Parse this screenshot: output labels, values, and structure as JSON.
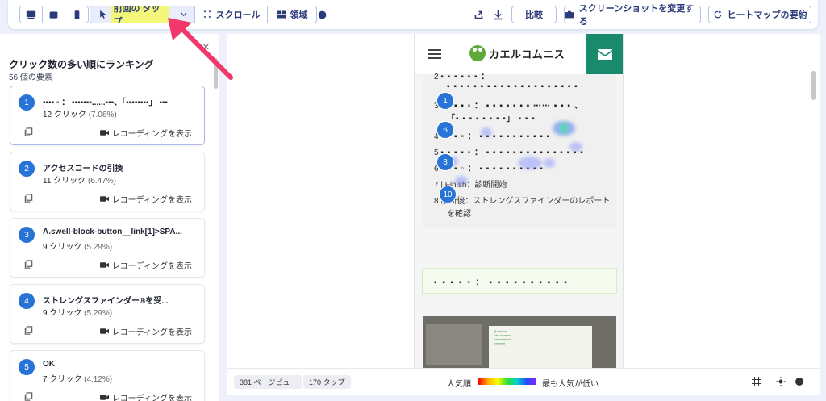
{
  "toolbar": {
    "tap_label": "前回の タップ",
    "scroll_label": "スクロール",
    "area_label": "領域",
    "compare_label": "比較",
    "screenshot_label": "スクリーンショットを変更する",
    "summary_label": "ヒートマップの要約"
  },
  "ranking": {
    "title": "クリック数の多い順にランキング",
    "element_count": "56 個の要素",
    "items": [
      {
        "rank": "1",
        "title": "▪▪▪▪ ▫ ： ▪▪▪▪▪▪▪......▪▪▪、「▪▪▪▪▪▪▪▪」 ▪▪▪",
        "clicks": "12 クリック",
        "pct": "(7.06%)",
        "record": "レコーディングを表示"
      },
      {
        "rank": "2",
        "title": "アクセスコードの引換",
        "clicks": "11 クリック",
        "pct": "(6.47%)",
        "record": "レコーディングを表示"
      },
      {
        "rank": "3",
        "title": "A.swell-block-button__link[1]>SPA...",
        "clicks": "9 クリック",
        "pct": "(5.29%)",
        "record": "レコーディングを表示"
      },
      {
        "rank": "4",
        "title": "ストレングスファインダー®を受...",
        "clicks": "9 クリック",
        "pct": "(5.29%)",
        "record": "レコーディングを表示"
      },
      {
        "rank": "5",
        "title": "OK",
        "clicks": "7 クリック",
        "pct": "(4.12%)",
        "record": "レコーディングを表示"
      }
    ]
  },
  "preview": {
    "logo_text": "カエルコムニス",
    "toc": [
      {
        "num": "2",
        "text": "▪ ▪ ▪ ▪ ▪ ▪ ："
      },
      {
        "num": "",
        "text": "▪ ▪ ▪ ▪ ▪ ▪ ▪ ▪ ▪ ▪ ▪ ▪ ▪ ▪ ▪ ▪ ▪ ▪ ▪ ▪"
      },
      {
        "num": "3",
        "text": "▪ ▪ ▪ ▪ ▫ ： ▪ ▪ ▪ ▪ ▪ ▪ ▪ ⋯⋯ ▪ ▪ ▪ 、"
      },
      {
        "num": "",
        "text": "「▪ ▪ ▪ ▪ ▪ ▪ ▪ ▪」 ▪ ▪ ▪"
      },
      {
        "num": "4",
        "text": "▪ ▪ ▪ ▫ ： ▪ ▪ ▪ ▪ ▪ ▪ ▪ ▪ ▪ ▪ ▪"
      },
      {
        "num": "5",
        "text": "▪ ▪ ▪ ▪ ▫ ： ▪ ▪ ▪ ▪ ▪ ▪ ▪ ▪ ▪ ▪ ▪ ▪ ▪ ▪ ▪"
      },
      {
        "num": "6",
        "text": "▪ ▪ ▪ ▫ ： ▪ ▪ ▪ ▪ ▪ ▪ ▪ ▪ ▪ ▪"
      },
      {
        "num": "7",
        "text": "Finish：診断開始"
      },
      {
        "num": "8",
        "text": "診断後：ストレングスファインダーのレポート"
      },
      {
        "num": "",
        "text": "を確認"
      }
    ],
    "markers": [
      "1",
      "6",
      "8",
      "10"
    ],
    "callout": "▪ ▪ ▪ ▪ ▫ ： ▪ ▪ ▪ ▪ ▪ ▪ ▪ ▪ ▪ ▪"
  },
  "footer": {
    "pageviews": "381 ページビュー",
    "taps": "170 タップ",
    "popular": "人気順",
    "least_popular": "最も人気が低い"
  },
  "colors": {
    "accent": "#2873d6",
    "mail_bg": "#198a6c",
    "arrow": "#f0386b"
  }
}
